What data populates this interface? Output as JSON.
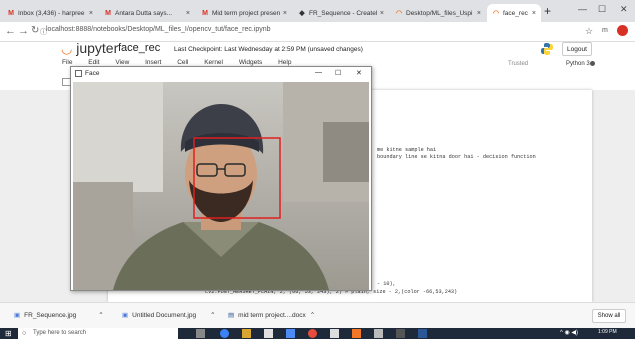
{
  "browser": {
    "tabs": [
      {
        "title": "Inbox (3,436) - harpree",
        "icon": "gmail-icon",
        "color": "#d93025",
        "glyph": "M"
      },
      {
        "title": "Antara Dutta says...",
        "icon": "gmail-icon",
        "color": "#d93025",
        "glyph": "M"
      },
      {
        "title": "Mid term project presen",
        "icon": "gmail-icon",
        "color": "#d93025",
        "glyph": "M"
      },
      {
        "title": "FR_Sequence - Creately",
        "icon": "creately-icon",
        "color": "#333333",
        "glyph": "◆"
      },
      {
        "title": "Desktop/ML_files_Uspi",
        "icon": "jupyter-icon",
        "color": "#f37626",
        "glyph": "◠"
      },
      {
        "title": "face_rec",
        "icon": "jupyter-icon",
        "color": "#f37626",
        "glyph": "◠"
      }
    ],
    "url": "localhost:8888/notebooks/Desktop/ML_files_I/opencv_tut/face_rec.ipynb",
    "new_tab": "+",
    "close_glyph": "×"
  },
  "jupyter": {
    "logo": "jupyter",
    "notebook_name": "face_rec",
    "checkpoint": "Last Checkpoint: Last Wednesday at 2:59 PM  (unsaved changes)",
    "logout": "Logout",
    "menu": [
      "File",
      "Edit",
      "View",
      "Insert",
      "Cell",
      "Kernel",
      "Widgets",
      "Help"
    ],
    "kernel_status": "Trusted",
    "kernel_name": "Python 3"
  },
  "code_lines": [
    "me kitne sample hai",
    "boundary line se kitna door hai - decision function",
    "- 10),",
    "cv2.FONT_HERSHEY_PLAIN, 2, (66, 53, 243), 2)  # plain, size - 2,(color -66,53,243)"
  ],
  "face_window": {
    "title": "Face",
    "minimize": "—",
    "maximize": "☐",
    "close": "✕",
    "detection_color": "#e02020"
  },
  "downloads": [
    {
      "name": "FR_Sequence.jpg"
    },
    {
      "name": "Untitled Document.jpg"
    },
    {
      "name": "mid term project....docx"
    }
  ],
  "show_all": "Show all",
  "taskbar": {
    "search_placeholder": "Type here to search",
    "time": "1:09 PM"
  }
}
